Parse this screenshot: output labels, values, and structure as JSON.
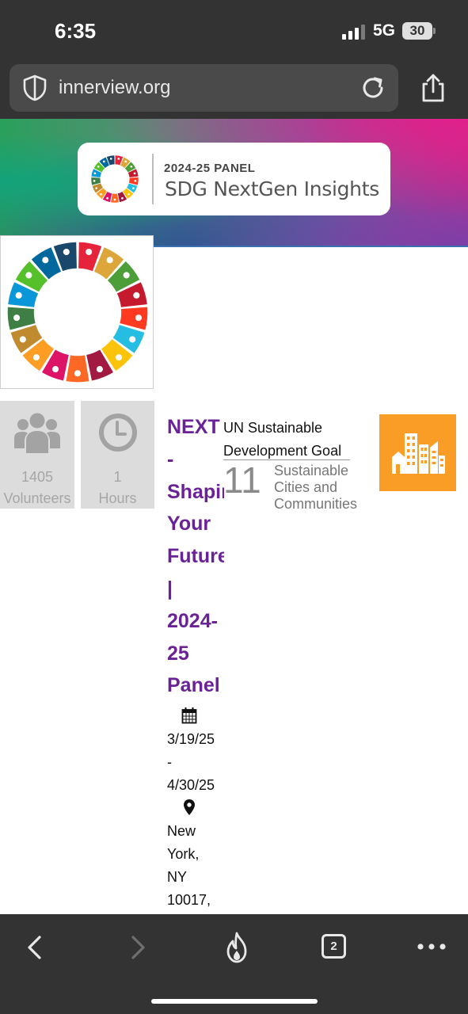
{
  "status_bar": {
    "time": "6:35",
    "network": "5G",
    "battery": "30"
  },
  "browser": {
    "url": "innerview.org",
    "tab_count": "2"
  },
  "banner": {
    "panel_label": "2024-25  PANEL",
    "title": "SDG NextGen Insights"
  },
  "stats": {
    "volunteers_value": "1405",
    "volunteers_label": "Volunteers",
    "hours_value": "1",
    "hours_label": "Hours"
  },
  "event": {
    "title_lines": [
      "NEXT",
      "-",
      "Shaping",
      "Your",
      "Future",
      "|",
      "2024-",
      "25",
      "Panel"
    ],
    "date_start": "3/19/25",
    "date_sep": "-",
    "date_end": "4/30/25",
    "location_lines": [
      "New",
      "York,",
      "NY",
      "10017,"
    ]
  },
  "goal": {
    "heading": "UN Sustainable Development Goal",
    "number": "11",
    "name": "Sustainable Cities and Communities"
  },
  "colors": {
    "chrome": "#333333",
    "event_title": "#6a2296",
    "goal_badge": "#f99d26",
    "stat_tile": "#dcdcdc",
    "sdg_wheel": [
      "#e5243b",
      "#dda63a",
      "#4c9f38",
      "#c5192d",
      "#ff3a21",
      "#26bde2",
      "#fcc30b",
      "#a21942",
      "#fd6925",
      "#dd1367",
      "#fd9d24",
      "#bf8b2e",
      "#3f7e44",
      "#0a97d9",
      "#56c02b",
      "#00689d",
      "#19486a"
    ]
  },
  "icons": {
    "signal": "signal-bars-icon",
    "shield": "shield-icon",
    "reload": "reload-icon",
    "share": "share-icon",
    "volunteers": "people-icon",
    "hours": "clock-icon",
    "calendar": "calendar-icon",
    "location": "map-pin-icon",
    "goal": "city-buildings-icon",
    "back": "chevron-left-icon",
    "forward": "chevron-right-icon",
    "burn": "fire-icon",
    "more": "more-dots-icon"
  }
}
